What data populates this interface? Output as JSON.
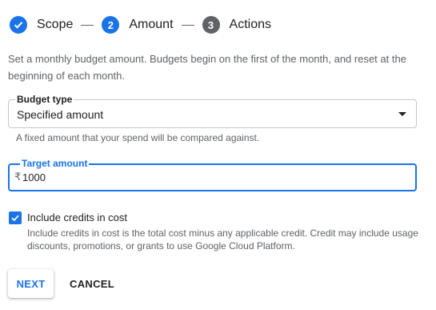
{
  "stepper": {
    "steps": [
      {
        "label": "Scope",
        "number": "1",
        "state": "done"
      },
      {
        "label": "Amount",
        "number": "2",
        "state": "active"
      },
      {
        "label": "Actions",
        "number": "3",
        "state": "todo"
      }
    ]
  },
  "description": "Set a monthly budget amount. Budgets begin on the first of the month, and reset at the beginning of each month.",
  "budget_type": {
    "label": "Budget type",
    "value": "Specified amount",
    "hint": "A fixed amount that your spend will be compared against."
  },
  "target_amount": {
    "label": "Target amount",
    "currency_symbol": "₹",
    "value": "1000"
  },
  "include_credits": {
    "label": "Include credits in cost",
    "checked": true,
    "help": "Include credits in cost is the total cost minus any applicable credit. Credit may include usage discounts, promotions, or grants to use Google Cloud Platform."
  },
  "buttons": {
    "next_label": "NEXT",
    "cancel_label": "CANCEL"
  },
  "colors": {
    "accent": "#1a73e8",
    "inactive_step": "#5f6368"
  }
}
